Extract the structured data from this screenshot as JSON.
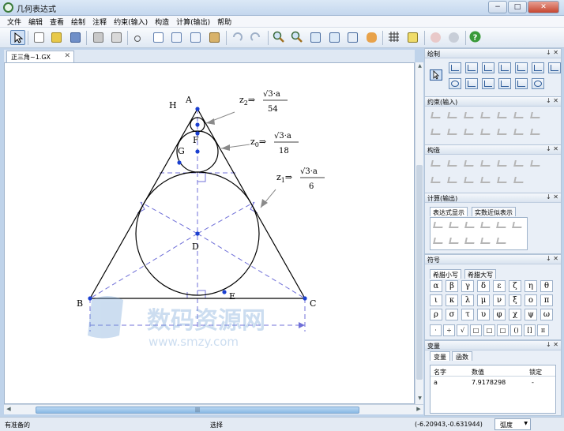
{
  "window": {
    "title": "几何表达式",
    "minimize": "−",
    "maximize": "□",
    "close": "✕"
  },
  "menu": [
    "文件",
    "编辑",
    "查看",
    "绘制",
    "注释",
    "约束(输入)",
    "构造",
    "计算(输出)",
    "帮助"
  ],
  "toolbar": {
    "icons": [
      "select-arrow-icon",
      "new-icon",
      "open-icon",
      "save-icon",
      "print-icon",
      "print-preview-icon",
      "cut-icon",
      "copy-icon",
      "copy-drawing-icon",
      "copy-as-icon",
      "paste-icon",
      "undo-icon",
      "redo-icon",
      "zoom-in-icon",
      "zoom-out-icon",
      "zoom-to-fit-icon",
      "zoom-window-icon",
      "zoom-icon",
      "pan-hand-icon",
      "grid-icon",
      "style-icon",
      "plugin-icon",
      "plugin2-icon",
      "help-icon"
    ]
  },
  "doc_tab": {
    "label": "正三角~1.GX",
    "close": "✕"
  },
  "drawing": {
    "points": {
      "A": "A",
      "B": "B",
      "C": "C",
      "D": "D",
      "E": "E",
      "F": "F",
      "G": "G",
      "H": "H"
    },
    "expressions": [
      {
        "var": "z",
        "sub": "2",
        "arrow": "⇒",
        "num_root": "3",
        "num_rest": "·a",
        "den": "54"
      },
      {
        "var": "z",
        "sub": "0",
        "arrow": "⇒",
        "num_root": "3",
        "num_rest": "·a",
        "den": "18"
      },
      {
        "var": "z",
        "sub": "1",
        "arrow": "⇒",
        "num_root": "3",
        "num_rest": "·a",
        "den": "6"
      }
    ],
    "radical": "√"
  },
  "watermark": {
    "title": "数码资源网",
    "url": "www.smzy.com"
  },
  "panels": {
    "draw": {
      "title": "绘制",
      "pins": "↓ ✕"
    },
    "constrain": {
      "title": "约束(输入)",
      "pins": "↓ ✕"
    },
    "construct": {
      "title": "构造",
      "pins": "↓ ✕"
    },
    "calculate": {
      "title": "计算(输出)",
      "pins": "↓ ✕",
      "tabs": [
        "表达式显示",
        "实数近似表示"
      ]
    },
    "symbols": {
      "title": "符号",
      "pins": "↓ ✕",
      "tabs": [
        "希腊小写",
        "希腊大写"
      ],
      "greek": [
        "α",
        "β",
        "γ",
        "δ",
        "ε",
        "ζ",
        "η",
        "θ",
        "ι",
        "κ",
        "λ",
        "μ",
        "ν",
        "ξ",
        "ο",
        "π",
        "ρ",
        "σ",
        "τ",
        "υ",
        "φ",
        "χ",
        "ψ",
        "ω"
      ],
      "extra": [
        "·",
        "÷",
        "√",
        "□",
        "□",
        "□",
        "()",
        "[]",
        "π"
      ]
    },
    "variables": {
      "title": "变量",
      "pins": "↓ ✕",
      "tabs": [
        "变量",
        "函数"
      ],
      "headers": {
        "name": "名字",
        "value": "数值",
        "locked": "锁定"
      },
      "rows": [
        {
          "name": "a",
          "value": "7.9178298",
          "locked": "-"
        }
      ]
    }
  },
  "status": {
    "left": "有准备的",
    "mode": "选择",
    "coords": "(-6.20943,-0.631944)",
    "unit": "弧度"
  },
  "colors": {
    "accent": "#2f5fa8",
    "point": "#1a3fd0",
    "dash": "#7070d8",
    "arrow": "#888888"
  }
}
